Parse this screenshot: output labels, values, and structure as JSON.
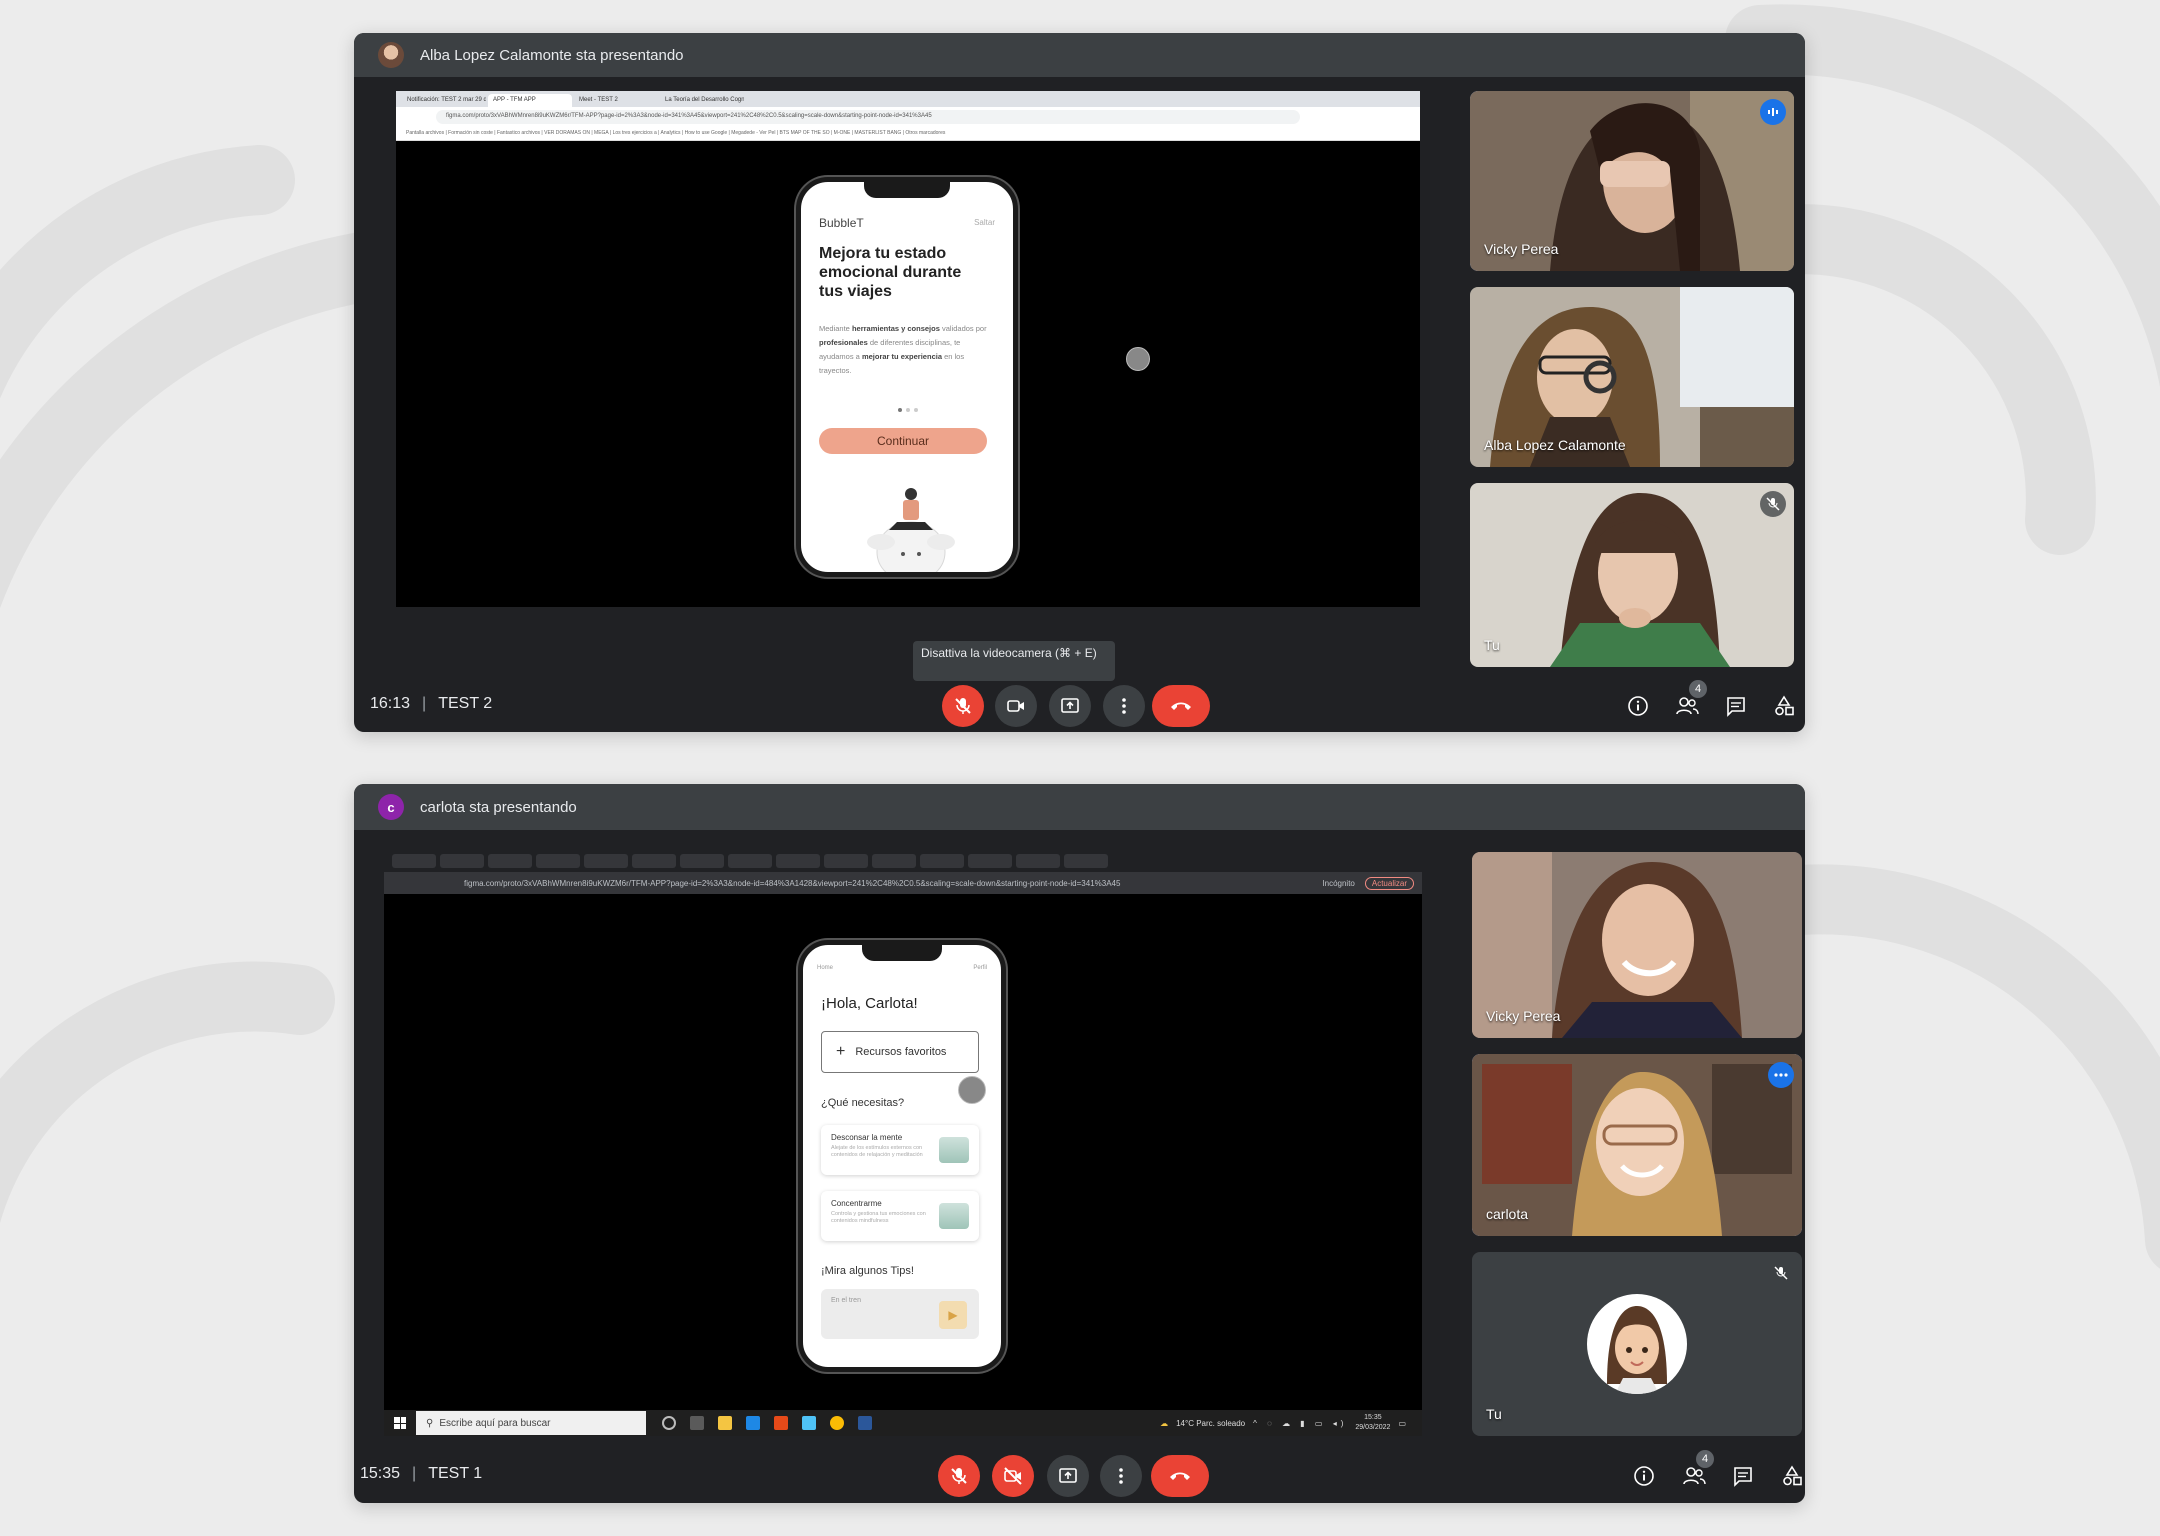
{
  "top_call": {
    "presenter_text": "Alba Lopez Calamonte sta presentando",
    "time": "16:13",
    "meeting_name": "TEST 2",
    "participants_count": "4",
    "tooltip": "Disattiva la videocamera (⌘ + E)",
    "browser": {
      "tabs": [
        "Notificación: TEST 2 mar 29 de",
        "APP - TFM APP",
        "Meet - TEST 2",
        "La Teoría del Desarrollo Cogniti"
      ],
      "url": "figma.com/proto/3xVABhWMnren8i9uKWZM6r/TFM-APP?page-id=2%3A3&node-id=341%3A45&viewport=241%2C48%2C0.5&scaling=scale-down&starting-point-node-id=341%3A45",
      "bookmarks": "Pantalla archivos | Formación sin coste | Fantastico archivos | VER DORAMAS ON | MEGA | Los tres ejercicios a | Analytics | How to use Google | Megadede - Ver Pel | BTS MAP OF THE SO | M-ONE | MASTERLIST BANG | Otros marcadores"
    },
    "phone": {
      "brand": "BubbleT",
      "skip": "Saltar",
      "headline": "Mejora tu estado emocional durante tus viajes",
      "body_1": "Mediante ",
      "body_b1": "herramientas y consejos",
      "body_2": " validados por ",
      "body_b2": "profesionales",
      "body_3": " de diferentes disciplinas, te ayudamos a ",
      "body_b3": "mejorar tu experiencia",
      "body_4": " en los trayectos.",
      "cta": "Continuar"
    },
    "tiles": [
      {
        "name": "Vicky Perea",
        "speaking": true
      },
      {
        "name": "Alba Lopez Calamonte",
        "speaking": false
      },
      {
        "name": "Tu",
        "muted": true
      }
    ]
  },
  "bottom_call": {
    "presenter_initial": "c",
    "presenter_text": "carlota sta presentando",
    "time": "15:35",
    "meeting_name": "TEST 1",
    "participants_count": "4",
    "browser": {
      "url": "figma.com/proto/3xVABhWMnren8i9uKWZM6r/TFM-APP?page-id=2%3A3&node-id=484%3A1428&viewport=241%2C48%2C0.5&scaling=scale-down&starting-point-node-id=341%3A45",
      "incognito": "Incógnito",
      "update": "Actualizar"
    },
    "taskbar": {
      "search_placeholder": "Escribe aquí para buscar",
      "weather": "14°C  Parc. soleado",
      "clock_time": "15:35",
      "clock_date": "29/03/2022"
    },
    "phone": {
      "nav_home": "Home",
      "nav_profile": "Perfil",
      "greeting": "¡Hola, Carlota!",
      "favorites": "Recursos favoritos",
      "question": "¿Qué necesitas?",
      "card1_title": "Desconsar la mente",
      "card1_desc": "Alejate de los estímulos externos con contenidos de relajación y meditación",
      "card2_title": "Concentrarme",
      "card2_desc": "Controla y gestiona tus emociones con contenidos mindfulness",
      "tips": "¡Mira algunos Tips!",
      "tip1_title": "En el tren"
    },
    "tiles": [
      {
        "name": "Vicky Perea"
      },
      {
        "name": "carlota",
        "speaking": true
      },
      {
        "name": "Tu",
        "muted": true
      }
    ]
  },
  "colors": {
    "meet_bg": "#202124",
    "present_bar": "#3c4043",
    "red": "#ea4335",
    "speaking_border": "#8ab4f8",
    "cta": "#eea48c"
  }
}
